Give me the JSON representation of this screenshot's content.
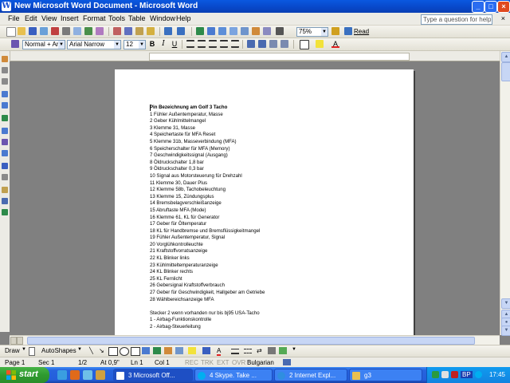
{
  "window": {
    "title": "New Microsoft Word Document - Microsoft Word"
  },
  "menu": {
    "items": [
      "File",
      "Edit",
      "View",
      "Insert",
      "Format",
      "Tools",
      "Table",
      "Window",
      "Help"
    ],
    "help_placeholder": "Type a question for help"
  },
  "toolbar": {
    "zoom": "75%",
    "read_label": "Read",
    "style": "Normal + Arial",
    "font": "Arial Narrow",
    "size": "12"
  },
  "document": {
    "heading": "Pin Bezeichnung am Golf 3 Tacho",
    "lines": [
      "1 Fühler Außentemperatur, Masse",
      "2 Geber Kühlmittelmangel",
      "3 Klemme 31, Masse",
      "4 Speichertaste für MFA Reset",
      "5 Klemme 31b, Masseverbindung (MFA)",
      "6 Speicherschalter für MFA (Memory)",
      "7 Geschwindigkeitssignal (Ausgang)",
      "8 Öldruckschalter 1,8 bar",
      "9 Öldruckschalter 0,3 bar",
      "10 Signal aus Motorsteuerung für Drehzahl",
      "11 Klemme 30, Dauer Plus",
      "12 Klemme 58b, Tachobeleuchtung",
      "13 Klemme 15, Zündungsplus",
      "14 Bremsbelagverschleißanzeige",
      "15 Abruftaste MFA (Mode)",
      "16 Klemme 61, KL für Generator",
      "17 Geber für Öltemperatur",
      "18 KL für Handbremse und Bremsflüssigkeitmangel",
      "19 Fühler Außentemperatur, Signal",
      "20 Vorglühkontrolleuchte",
      "21 Kraftstoffvorratsanzeige",
      "22 KL Blinker links",
      "23 Kühlmitteltemperaturanzeige",
      "24 KL Blinker rechts",
      "25 KL Fernlicht",
      "26 Gebersignal Kraftstoffverbrauch",
      "27 Geber für Geschwindigkeit, Hallgeber am Getriebe",
      "28 Wählbereichsanzeige MFA"
    ],
    "paragraph2": [
      "Stecker 2 wenn vorhanden nur bis bj95 USA-Tacho",
      "1 - Airbag-Funktionskontrolle",
      "2 - Airbag-Steuerleitung"
    ]
  },
  "draw_toolbar": {
    "draw_label": "Draw",
    "autoshapes_label": "AutoShapes"
  },
  "status": {
    "page": "Page  1",
    "sec": "Sec  1",
    "pages": "1/2",
    "at": "At  0,9\"",
    "ln": "Ln  1",
    "col": "Col  1",
    "rec": "REC",
    "trk": "TRK",
    "ext": "EXT",
    "ovr": "OVR",
    "language": "Bulgarian"
  },
  "taskbar": {
    "start_label": "start",
    "tasks": [
      {
        "label": "3 Microsoft Off...",
        "active": true
      },
      {
        "label": "4 Skype. Take ...",
        "active": false
      },
      {
        "label": "2 Internet Expl...",
        "active": false
      },
      {
        "label": "g3",
        "active": false
      }
    ],
    "lang_indicator": "BP",
    "clock": "17:45"
  },
  "colors": {
    "titlebar": "#0a58e0",
    "taskbar": "#245edb",
    "start": "#2f9a2f",
    "workspace": "#808080"
  }
}
